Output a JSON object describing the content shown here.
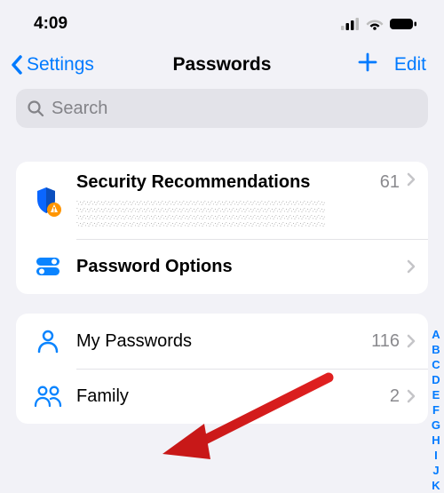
{
  "status": {
    "time": "4:09"
  },
  "nav": {
    "back": "Settings",
    "title": "Passwords",
    "edit": "Edit"
  },
  "search": {
    "placeholder": "Search"
  },
  "groups": [
    {
      "rows": [
        {
          "title": "Security Recommendations",
          "count": "61"
        },
        {
          "title": "Password Options"
        }
      ]
    },
    {
      "rows": [
        {
          "title": "My Passwords",
          "count": "116"
        },
        {
          "title": "Family",
          "count": "2"
        }
      ]
    }
  ],
  "index": [
    "A",
    "B",
    "C",
    "D",
    "E",
    "F",
    "G",
    "H",
    "I",
    "J",
    "K"
  ]
}
